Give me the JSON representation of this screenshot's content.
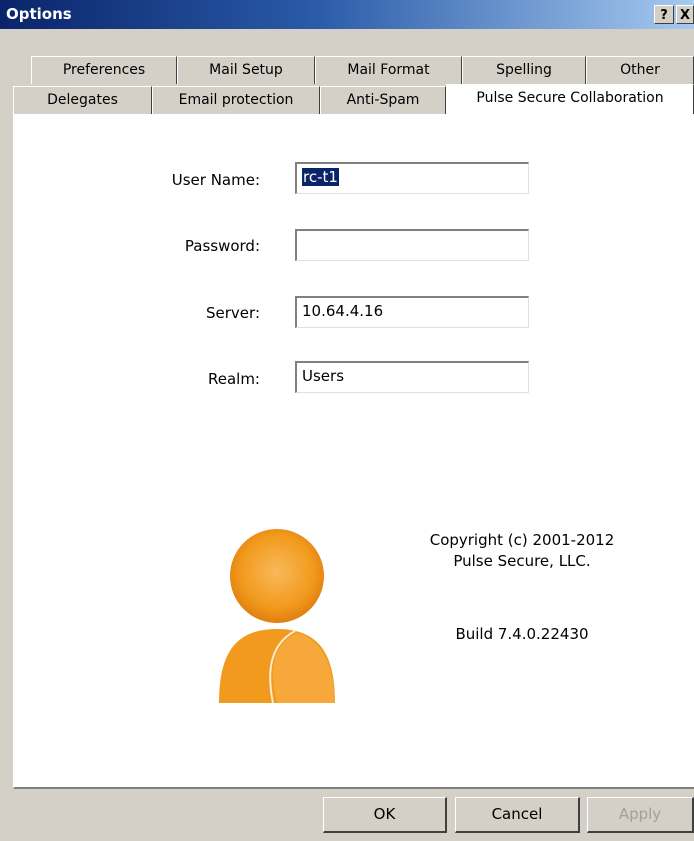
{
  "window": {
    "title": "Options",
    "help_label": "?",
    "close_label": "X"
  },
  "tabs_row1": [
    "Preferences",
    "Mail Setup",
    "Mail Format",
    "Spelling",
    "Other"
  ],
  "tabs_row2": [
    "Delegates",
    "Email protection",
    "Anti-Spam",
    "Pulse Secure Collaboration"
  ],
  "active_tab": "Pulse Secure Collaboration",
  "form": {
    "username_label": "User Name:",
    "username_value": "rc-t1",
    "password_label": "Password:",
    "password_value": "",
    "server_label": "Server:",
    "server_value": "10.64.4.16",
    "realm_label": "Realm:",
    "realm_value": "Users"
  },
  "info": {
    "copyright": "Copyright (c) 2001-2012",
    "company": "Pulse Secure, LLC.",
    "build": "Build 7.4.0.22430"
  },
  "buttons": {
    "ok": "OK",
    "cancel": "Cancel",
    "apply": "Apply"
  },
  "colors": {
    "title_start": "#0a246a",
    "title_end": "#a6caf0",
    "user_icon": "#f29a1d"
  },
  "icons": {
    "logo": "user-person-icon"
  }
}
